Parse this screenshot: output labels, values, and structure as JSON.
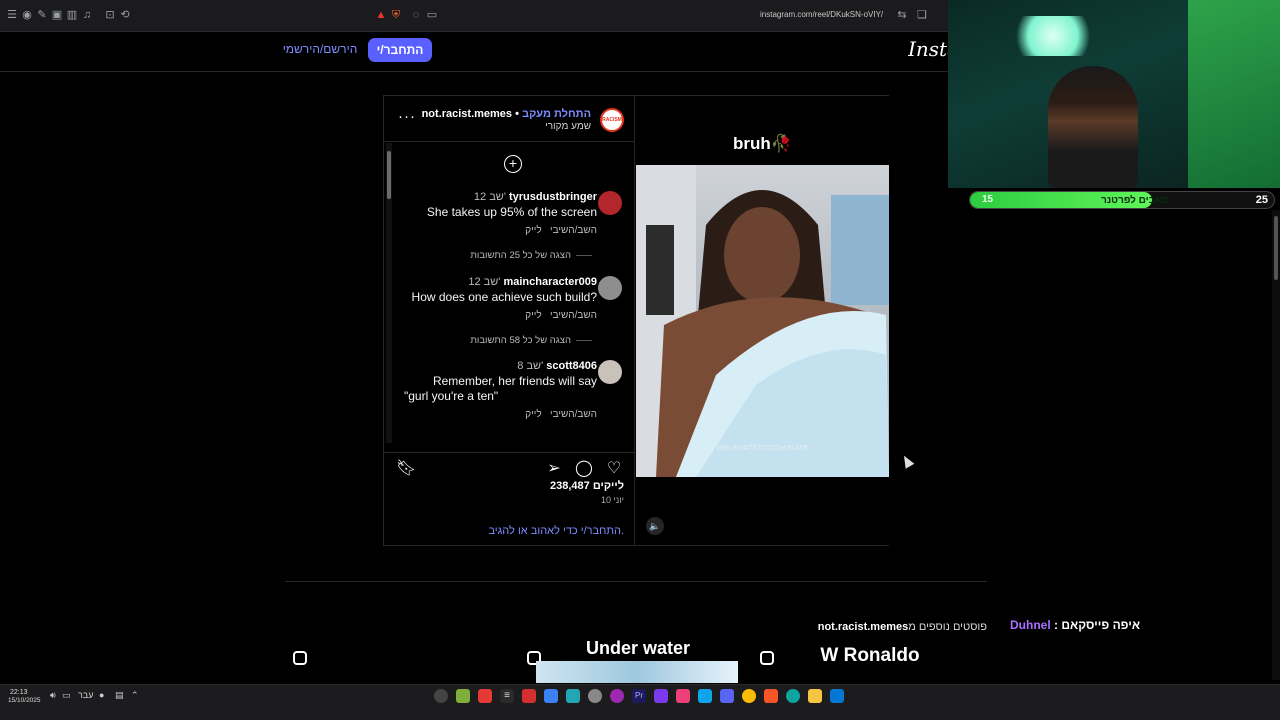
{
  "browser": {
    "url": "instagram.com/reel/DKukSN-oVIY/",
    "icons": [
      "menu-icon",
      "location-icon",
      "pin-icon",
      "tabs-icon",
      "sidebar-icon",
      "music-icon",
      "screenshot-icon",
      "extensions-icon",
      "warning-icon",
      "brave-shield-icon",
      "whatsapp-icon",
      "cast-icon",
      "translate-icon",
      "bookmark-icon"
    ]
  },
  "header": {
    "logo": "Insta",
    "login_label": "התחבר/י",
    "signup_label": "הירשם/הירשמי"
  },
  "post": {
    "username": "not.racist.memes",
    "follow_label": "התחלת מעקב",
    "audio_label": "שמע מקורי",
    "avatar_text": "RACISM",
    "media_caption": "bruh🥀",
    "watermark": "@ELEVATETODOMINATE",
    "likes": "238,487 לייקים",
    "date": "10 יוני",
    "login_prompt_link": "התחבר/י",
    "login_prompt_text": " כדי לאהוב או להגיב."
  },
  "comments": [
    {
      "user": "tyrusdustbringer",
      "time": "12 שב'",
      "text": "She takes up 95% of the screen",
      "like_label": "לייק",
      "reply_label": "השב/השיבי",
      "replies_label": "הצגה של כל 25 התשובות",
      "avatar_color": "#b3262b"
    },
    {
      "user": "maincharacter009",
      "time": "12 שב'",
      "text": "How does one achieve such build?",
      "like_label": "לייק",
      "reply_label": "השב/השיבי",
      "replies_label": "הצגה של כל 58 התשובות",
      "avatar_color": "#8e8e8e"
    },
    {
      "user": "scott8406",
      "time": "8 שב'",
      "text_line1": "Remember, her friends will say",
      "text_line2": "\"gurl you're a ten\"",
      "like_label": "לייק",
      "reply_label": "השב/השיבי",
      "avatar_color": "#c8c2b8"
    }
  ],
  "more_posts": {
    "label": "פוסטים נוספים מ",
    "user": "not.racist.memes",
    "thumbs": [
      "Under water",
      "W Ronaldo"
    ]
  },
  "stream": {
    "progress_current": "15",
    "progress_goal": "25",
    "progress_label": "סאבים לפרטנר",
    "progress_fraction": 0.6,
    "chat_user": "Duhnel",
    "chat_message": ": איפה פייסקאם"
  },
  "taskbar": {
    "time": "22:13",
    "date": "15/10/2025",
    "lang": "עבר"
  },
  "colors": {
    "accent": "#5a60ff",
    "link": "#7d8cff",
    "progress_green": "#2ecc40",
    "chat_purple": "#a970ff"
  }
}
